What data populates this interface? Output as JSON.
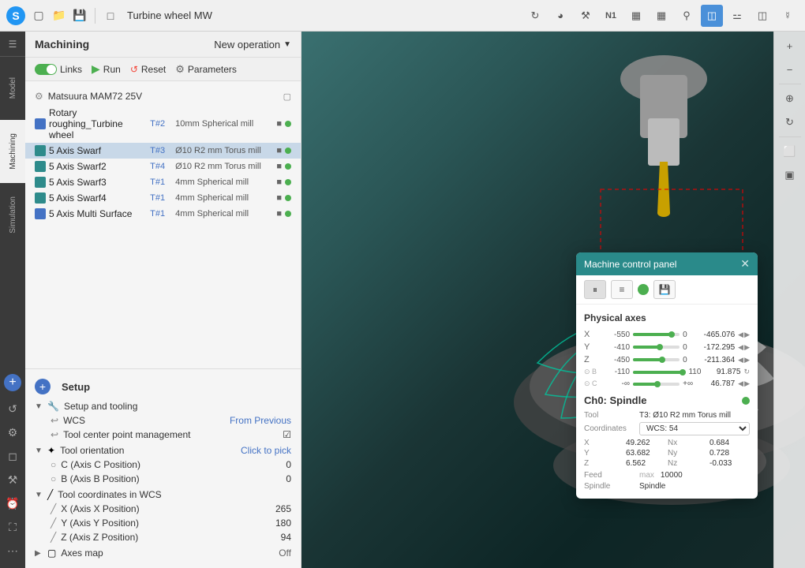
{
  "titlebar": {
    "logo": "S",
    "title": "Turbine wheel MW",
    "icons": [
      "file-new",
      "folder-open",
      "save",
      "window"
    ],
    "right_icons": [
      "refresh",
      "view3d",
      "tools",
      "n1",
      "chart",
      "grid",
      "search",
      "display",
      "wave",
      "screen",
      "globe"
    ]
  },
  "sidebar": {
    "tabs": [
      {
        "label": "Model",
        "active": false
      },
      {
        "label": "Machining",
        "active": true
      },
      {
        "label": "Simulation",
        "active": false
      }
    ],
    "bottom_icons": [
      "plus",
      "cursor",
      "settings",
      "layers",
      "clock",
      "map",
      "dots"
    ]
  },
  "machining": {
    "title": "Machining",
    "new_operation_label": "New operation",
    "toolbar": {
      "links_label": "Links",
      "run_label": "Run",
      "reset_label": "Reset",
      "parameters_label": "Parameters"
    },
    "machine_label": "Matsuura MAM72 25V",
    "operations": [
      {
        "name": "Rotary roughing_Turbine wheel",
        "tool": "T#2",
        "desc": "10mm Spherical mill",
        "icon_color": "blue",
        "checked": true,
        "dot": true,
        "selected": false
      },
      {
        "name": "5 Axis Swarf",
        "tool": "T#3",
        "desc": "Ø10 R2 mm Torus mill",
        "icon_color": "teal",
        "checked": true,
        "dot": true,
        "selected": true
      },
      {
        "name": "5 Axis Swarf2",
        "tool": "T#4",
        "desc": "Ø10 R2 mm Torus mill",
        "icon_color": "teal",
        "checked": true,
        "dot": true,
        "selected": false
      },
      {
        "name": "5 Axis Swarf3",
        "tool": "T#1",
        "desc": "4mm Spherical mill",
        "icon_color": "teal",
        "checked": true,
        "dot": true,
        "selected": false
      },
      {
        "name": "5 Axis Swarf4",
        "tool": "T#1",
        "desc": "4mm Spherical mill",
        "icon_color": "teal",
        "checked": true,
        "dot": true,
        "selected": false
      },
      {
        "name": "5 Axis Multi Surface",
        "tool": "T#1",
        "desc": "4mm Spherical mill",
        "icon_color": "blue",
        "checked": true,
        "dot": true,
        "selected": false
      }
    ]
  },
  "setup": {
    "title": "Setup",
    "sections": [
      {
        "label": "Setup and tooling",
        "expanded": true,
        "children": [
          {
            "label": "WCS",
            "value": "From Previous",
            "value_type": "link"
          },
          {
            "label": "Tool center point management",
            "value": "☑",
            "value_type": "check"
          }
        ]
      },
      {
        "label": "Tool orientation",
        "expanded": true,
        "value": "Click to pick",
        "value_type": "link",
        "children": [
          {
            "label": "C (Axis C Position)",
            "value": "0"
          },
          {
            "label": "B (Axis B Position)",
            "value": "0"
          }
        ]
      },
      {
        "label": "Tool coordinates in WCS",
        "expanded": true,
        "children": [
          {
            "label": "X (Axis X Position)",
            "value": "265"
          },
          {
            "label": "Y (Axis Y Position)",
            "value": "180"
          },
          {
            "label": "Z (Axis Z Position)",
            "value": "94"
          }
        ]
      },
      {
        "label": "Axes map",
        "expanded": false,
        "value": "Off",
        "value_type": "gray"
      }
    ]
  },
  "mcp": {
    "title": "Machine control panel",
    "tabs": [
      "pause",
      "settings",
      "circle",
      "save"
    ],
    "physical_axes_title": "Physical axes",
    "axes": [
      {
        "label": "X",
        "min": "-550",
        "max": "0",
        "value": "-465.076",
        "fill_pct": 80
      },
      {
        "label": "Y",
        "min": "-410",
        "max": "0",
        "value": "-172.295",
        "fill_pct": 55
      },
      {
        "label": "Z",
        "min": "-450",
        "max": "0",
        "value": "-211.364",
        "fill_pct": 60
      },
      {
        "label": "B",
        "min": "-110",
        "max": "110",
        "value": "91.875",
        "fill_pct": 93,
        "circular": true
      },
      {
        "label": "C",
        "min": "-∞",
        "max": "+∞",
        "value": "46.787",
        "fill_pct": 50,
        "circular": true
      }
    ],
    "spindle_title": "Ch0: Spindle",
    "tool_label": "Tool",
    "tool_value": "T3: Ø10 R2 mm Torus mill",
    "coordinates_label": "Coordinates",
    "coordinates_value": "WCS: 54",
    "coord_values": {
      "x_label": "X",
      "x_val": "49.262",
      "nx_label": "Nx",
      "nx_val": "0.684",
      "y_label": "Y",
      "y_val": "63.682",
      "ny_label": "Ny",
      "ny_val": "0.728",
      "z_label": "Z",
      "z_val": "6.562",
      "nz_label": "Nz",
      "nz_val": "-0.033"
    },
    "feed_label": "Feed",
    "feed_placeholder": "max",
    "feed_value": "10000",
    "spindle_label": "Spindle",
    "spindle_value": "Spindle"
  },
  "colors": {
    "accent": "#2a8a8a",
    "link": "#4472C4",
    "green": "#4CAF50",
    "selected_row": "#c8d8e8",
    "sidebar_bg": "#3a3a3a"
  }
}
